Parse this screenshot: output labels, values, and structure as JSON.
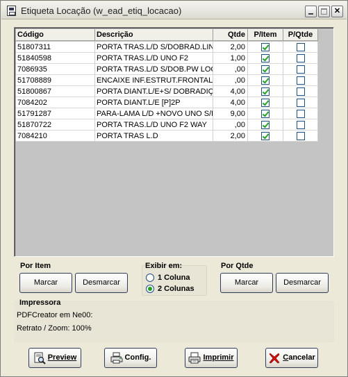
{
  "window": {
    "title": "Etiqueta Locação (w_ead_etiq_locacao)"
  },
  "grid": {
    "columns": [
      "Código",
      "Descrição",
      "Qtde",
      "P/Item",
      "P/Qtde"
    ],
    "rows": [
      {
        "codigo": "51807311",
        "descricao": "PORTA TRAS.L/D S/DOBRAD.LINEA",
        "qtde": "2,00",
        "p_item": true,
        "p_qtde": false
      },
      {
        "codigo": "51840598",
        "descricao": "PORTA TRAS.L/D UNO F2",
        "qtde": "1,00",
        "p_item": true,
        "p_qtde": false
      },
      {
        "codigo": "7086935",
        "descricao": "PORTA TRAS.L/D S/DOB.PW LOCK",
        "qtde": ",00",
        "p_item": true,
        "p_qtde": false
      },
      {
        "codigo": "51708889",
        "descricao": "ENCAIXE INF.ESTRUT.FRONTAL",
        "qtde": ",00",
        "p_item": true,
        "p_qtde": false
      },
      {
        "codigo": "51800867",
        "descricao": "PORTA DIANT.L/E+S/ DOBRADIÇA",
        "qtde": "4,00",
        "p_item": true,
        "p_qtde": false
      },
      {
        "codigo": "7084202",
        "descricao": "PORTA DIANT.L/E [P]2P",
        "qtde": "4,00",
        "p_item": true,
        "p_qtde": false
      },
      {
        "codigo": "51791287",
        "descricao": "PARA-LAMA L/D +NOVO UNO S/FU",
        "qtde": "9,00",
        "p_item": true,
        "p_qtde": false
      },
      {
        "codigo": "51870722",
        "descricao": "PORTA TRAS.L/D UNO F2 WAY",
        "qtde": ",00",
        "p_item": true,
        "p_qtde": false
      },
      {
        "codigo": "7084210",
        "descricao": "PORTA TRAS L.D",
        "qtde": "2,00",
        "p_item": true,
        "p_qtde": false
      }
    ]
  },
  "por_item": {
    "label": "Por Item",
    "marcar": "Marcar",
    "desmarcar": "Desmarcar"
  },
  "exibir_em": {
    "label": "Exibir em:",
    "options": [
      {
        "label": "1 Coluna",
        "selected": false
      },
      {
        "label": "2 Colunas",
        "selected": true
      }
    ]
  },
  "por_qtde": {
    "label": "Por Qtde",
    "marcar": "Marcar",
    "desmarcar": "Desmarcar"
  },
  "impressora": {
    "label": "Impressora",
    "printer": "PDFCreator em Ne00:",
    "orientation": "Retrato / Zoom: 100%"
  },
  "buttons": {
    "preview": {
      "label": "Preview",
      "icon": "preview-icon"
    },
    "config": {
      "label": "Config.",
      "icon": "printer-config-icon"
    },
    "imprimir": {
      "label": "Imprimir",
      "icon": "printer-icon"
    },
    "cancelar": {
      "label": "Cancelar",
      "icon": "red-x-icon"
    }
  },
  "colors": {
    "check": "#21a121",
    "cancel_x": "#d01010",
    "grid_background": "#c4c4c4",
    "window_background": "#ece9d8"
  }
}
